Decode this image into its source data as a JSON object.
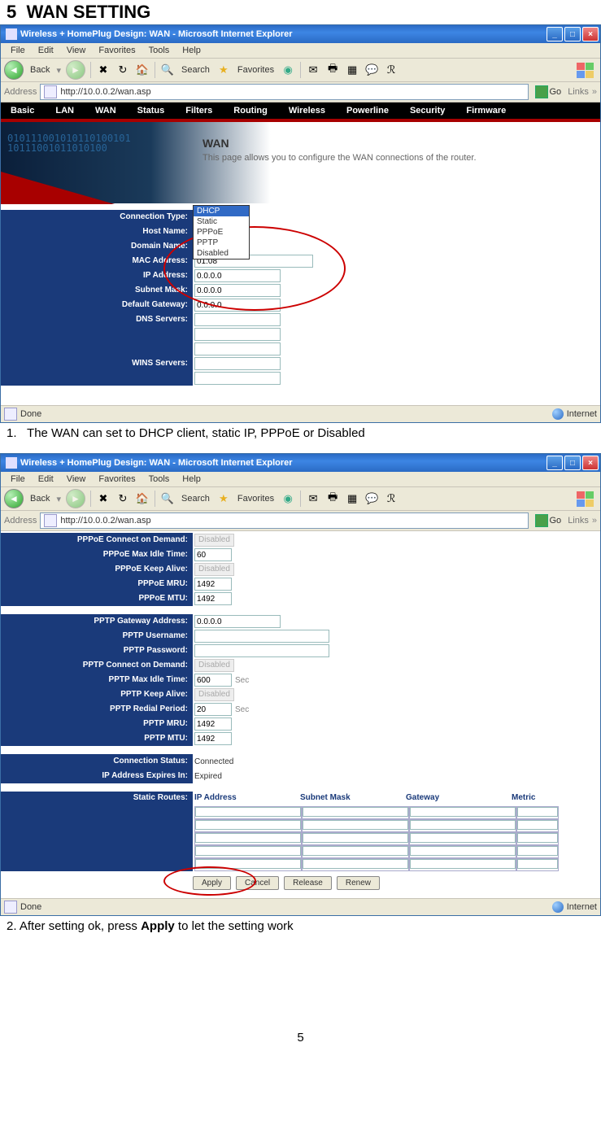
{
  "section": {
    "number": "5",
    "title": "WAN SETTING"
  },
  "caption1_num": "1.",
  "caption1": "The WAN can set to DHCP client, static IP, PPPoE or Disabled",
  "caption2_prefix": "2. After setting ok, press ",
  "caption2_bold": "Apply",
  "caption2_suffix": " to let the setting work",
  "page_number": "5",
  "window": {
    "title": "Wireless + HomePlug Design: WAN - Microsoft Internet Explorer",
    "menu": {
      "file": "File",
      "edit": "Edit",
      "view": "View",
      "favorites": "Favorites",
      "tools": "Tools",
      "help": "Help"
    },
    "toolbar": {
      "back": "Back",
      "search": "Search",
      "favorites": "Favorites"
    },
    "address_label": "Address",
    "url": "http://10.0.0.2/wan.asp",
    "go": "Go",
    "links": "Links",
    "status_done": "Done",
    "status_zone": "Internet"
  },
  "nav": {
    "basic": "Basic",
    "lan": "LAN",
    "wan": "WAN",
    "status": "Status",
    "filters": "Filters",
    "routing": "Routing",
    "wireless": "Wireless",
    "powerline": "Powerline",
    "security": "Security",
    "firmware": "Firmware"
  },
  "hero": {
    "bits1": "010111001010110100101",
    "bits2": "10111001011010100",
    "title": "WAN",
    "desc": "This page allows you to configure the WAN connections of the router."
  },
  "wan1": {
    "labels": {
      "conn_type": "Connection Type:",
      "host": "Host Name:",
      "domain": "Domain Name:",
      "mac": "MAC Address:",
      "ip": "IP Address:",
      "subnet": "Subnet Mask:",
      "gateway": "Default Gateway:",
      "dns": "DNS Servers:",
      "wins": "WINS Servers:"
    },
    "conn_type_value": "DHCP",
    "conn_options": [
      "DHCP",
      "Static",
      "PPPoE",
      "PPTP",
      "Disabled"
    ],
    "mac": "01:08",
    "ip": "0.0.0.0",
    "subnet": "0.0.0.0",
    "gateway": "0.0.0.0"
  },
  "wan2": {
    "labels": {
      "pppoe_cod": "PPPoE Connect on Demand:",
      "pppoe_idle": "PPPoE Max Idle Time:",
      "pppoe_keep": "PPPoE Keep Alive:",
      "pppoe_mru": "PPPoE MRU:",
      "pppoe_mtu": "PPPoE MTU:",
      "pptp_gw": "PPTP Gateway Address:",
      "pptp_user": "PPTP Username:",
      "pptp_pass": "PPTP Password:",
      "pptp_cod": "PPTP Connect on Demand:",
      "pptp_idle": "PPTP Max Idle Time:",
      "pptp_keep": "PPTP Keep Alive:",
      "pptp_redial": "PPTP Redial Period:",
      "pptp_mru": "PPTP MRU:",
      "pptp_mtu": "PPTP MTU:",
      "conn_status": "Connection Status:",
      "ip_expires": "IP Address Expires In:",
      "static_routes": "Static Routes:"
    },
    "values": {
      "pppoe_cod": "Disabled",
      "pppoe_idle": "60",
      "pppoe_keep": "Disabled",
      "pppoe_mru": "1492",
      "pppoe_mtu": "1492",
      "pptp_gw": "0.0.0.0",
      "pptp_cod": "Disabled",
      "pptp_idle": "600",
      "pptp_idle_unit": "Sec",
      "pptp_keep": "Disabled",
      "pptp_redial": "20",
      "pptp_redial_unit": "Sec",
      "pptp_mru": "1492",
      "pptp_mtu": "1492",
      "conn_status": "Connected",
      "ip_expires": "Expired"
    },
    "routes_head": {
      "ip": "IP Address",
      "subnet": "Subnet Mask",
      "gateway": "Gateway",
      "metric": "Metric"
    },
    "buttons": {
      "apply": "Apply",
      "cancel": "Cancel",
      "release": "Release",
      "renew": "Renew"
    }
  }
}
